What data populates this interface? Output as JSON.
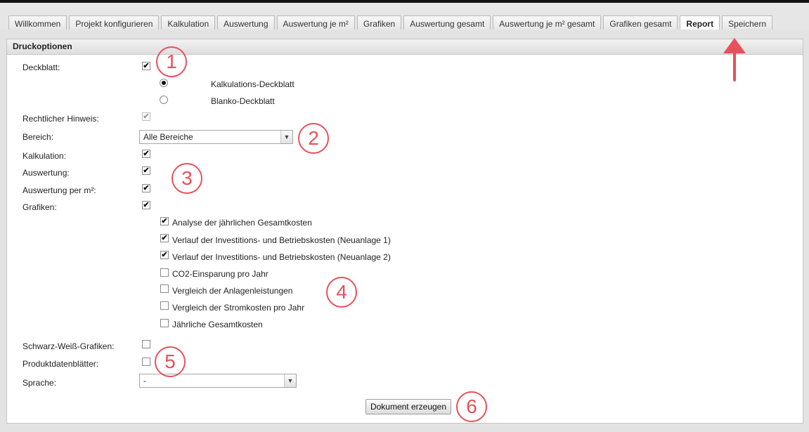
{
  "tabs": [
    {
      "label": "Willkommen",
      "active": false
    },
    {
      "label": "Projekt konfigurieren",
      "active": false
    },
    {
      "label": "Kalkulation",
      "active": false
    },
    {
      "label": "Auswertung",
      "active": false
    },
    {
      "label": "Auswertung je m²",
      "active": false
    },
    {
      "label": "Grafiken",
      "active": false
    },
    {
      "label": "Auswertung gesamt",
      "active": false
    },
    {
      "label": "Auswertung je m² gesamt",
      "active": false
    },
    {
      "label": "Grafiken gesamt",
      "active": false
    },
    {
      "label": "Report",
      "active": true
    },
    {
      "label": "Speichern",
      "active": false
    }
  ],
  "panel": {
    "title": "Druckoptionen"
  },
  "options": {
    "deckblatt": {
      "label": "Deckblatt:",
      "checked": true
    },
    "deckblatt_options": [
      {
        "label": "Kalkulations-Deckblatt",
        "selected": true
      },
      {
        "label": "Blanko-Deckblatt",
        "selected": false
      }
    ],
    "rechtlicher_hinweis": {
      "label": "Rechtlicher Hinweis:",
      "checked": true,
      "disabled": true
    },
    "bereich": {
      "label": "Bereich:",
      "value": "Alle Bereiche"
    },
    "kalkulation": {
      "label": "Kalkulation:",
      "checked": true
    },
    "auswertung": {
      "label": "Auswertung:",
      "checked": true
    },
    "auswertung_m2": {
      "label": "Auswertung per m²:",
      "checked": true
    },
    "grafiken": {
      "label": "Grafiken:",
      "checked": true
    },
    "grafiken_items": [
      {
        "label": "Analyse der jährlichen Gesamtkosten",
        "checked": true
      },
      {
        "label": "Verlauf der Investitions- und Betriebskosten (Neuanlage 1)",
        "checked": true
      },
      {
        "label": "Verlauf der Investitions- und Betriebskosten (Neuanlage 2)",
        "checked": true
      },
      {
        "label": "CO2-Einsparung pro Jahr",
        "checked": false
      },
      {
        "label": "Vergleich der Anlagenleistungen",
        "checked": false
      },
      {
        "label": "Vergleich der Stromkosten pro Jahr",
        "checked": false
      },
      {
        "label": "Jährliche Gesamtkosten",
        "checked": false
      }
    ],
    "schwarz_weiss": {
      "label": "Schwarz-Weiß-Grafiken:",
      "checked": false
    },
    "produktdatenblaetter": {
      "label": "Produktdatenblätter:",
      "checked": false
    },
    "sprache": {
      "label": "Sprache:",
      "value": "-"
    }
  },
  "button": {
    "label": "Dokument erzeugen"
  },
  "annotations": [
    "1",
    "2",
    "3",
    "4",
    "5",
    "6"
  ],
  "colors": {
    "annotation": "#e8505b"
  }
}
